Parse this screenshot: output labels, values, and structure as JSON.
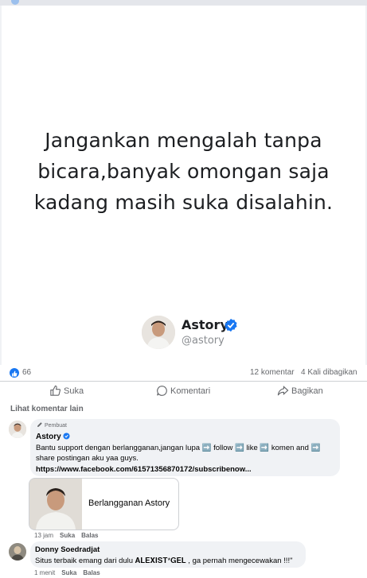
{
  "post": {
    "quote": "Jangankan mengalah tanpa bicara,banyak omongan saja kadang masih suka disalahin.",
    "brand_name": "Astory",
    "brand_handle": "@astory"
  },
  "stats": {
    "likes": "66",
    "comments": "12 komentar",
    "shares": "4 Kali dibagikan"
  },
  "actions": {
    "like": "Suka",
    "comment": "Komentari",
    "share": "Bagikan"
  },
  "comments": {
    "see_more": "Lihat komentar lain",
    "items": [
      {
        "badge": "Pembuat",
        "author": "Astory",
        "text": "Bantu support dengan berlangganan,jangan lupa ➡️ follow ➡️ like ➡️ komen and ➡️ share postingan aku yaa guys.",
        "link": "https://www.facebook.com/61571356870172/subscribenow...",
        "card_label": "Berlangganan Astory",
        "time": "13 jam",
        "like": "Suka",
        "reply": "Balas"
      },
      {
        "author": "Donny Soedradjat",
        "text": "Situs terbaik emang dari dulu 𝐀𝐋𝐄𝐗𝐈𝐒𝐓*𝐆𝐄𝐋 , ga pernah mengecewakan !!!\"",
        "time": "1 menit",
        "like": "Suka",
        "reply": "Balas"
      }
    ]
  },
  "colors": {
    "accent": "#1877f2",
    "muted": "#65676b",
    "bubble": "#f0f2f5"
  }
}
